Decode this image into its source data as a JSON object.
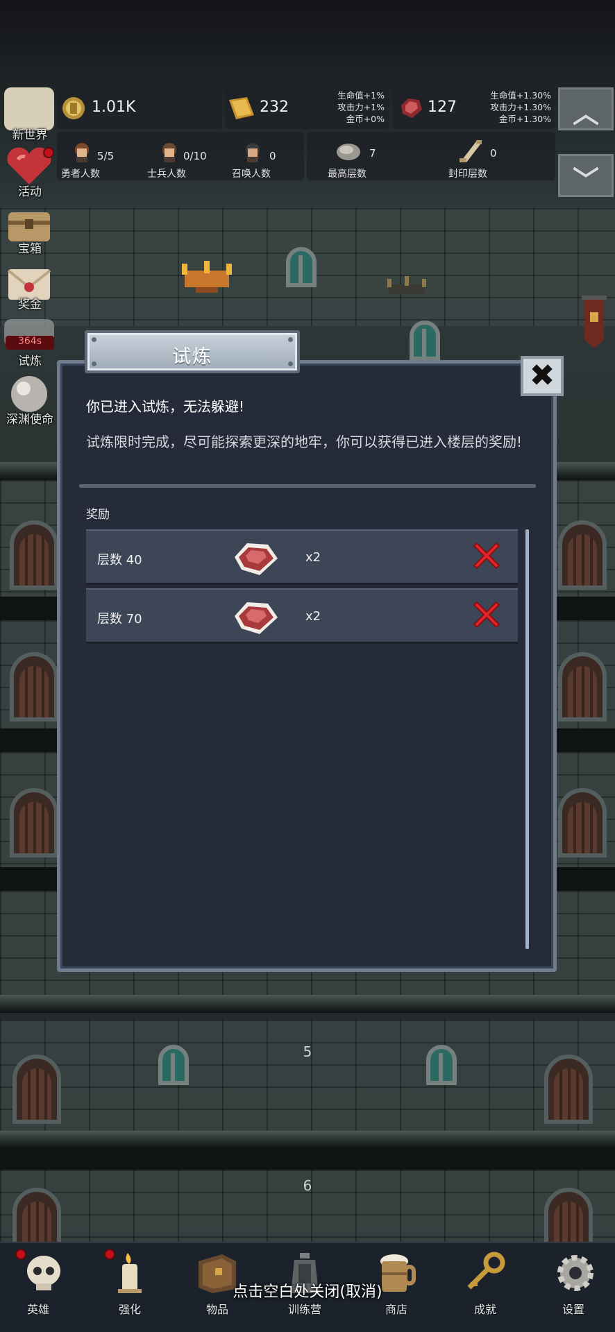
{
  "resources": {
    "gold": "1.01K",
    "bread": "232",
    "bread_bonus": [
      "生命值+1%",
      "攻击力+1%",
      "金币+0%"
    ],
    "gem": "127",
    "gem_bonus": [
      "生命值+1.30%",
      "攻击力+1.30%",
      "金币+1.30%"
    ]
  },
  "counts": [
    {
      "value": "5/5",
      "label": "勇者人数"
    },
    {
      "value": "0/10",
      "label": "士兵人数"
    },
    {
      "value": "0",
      "label": "召唤人数"
    },
    {
      "value": "7",
      "label": "最高层数"
    },
    {
      "value": "0",
      "label": "封印层数"
    }
  ],
  "left_menu": [
    {
      "label": "新世界"
    },
    {
      "label": "活动"
    },
    {
      "label": "宝箱"
    },
    {
      "label": "奖金"
    },
    {
      "label": "试炼",
      "badge": "364s"
    },
    {
      "label": "深渊使命"
    }
  ],
  "floors": [
    "5",
    "6"
  ],
  "modal": {
    "title": "试炼",
    "message_1": "你已进入试炼，无法躲避!",
    "message_2": "试炼限时完成，尽可能探索更深的地牢，你可以获得已进入楼层的奖励!",
    "rewards_heading": "奖励",
    "rows": [
      {
        "label": "层数 40",
        "qty": "x2"
      },
      {
        "label": "层数 70",
        "qty": "x2"
      }
    ]
  },
  "bottom_nav": [
    {
      "label": "英雄"
    },
    {
      "label": "强化"
    },
    {
      "label": "物品"
    },
    {
      "label": "训练营"
    },
    {
      "label": "商店"
    },
    {
      "label": "成就"
    },
    {
      "label": "设置"
    }
  ],
  "tap_to_close": "点击空白处关闭(取消)",
  "colors": {
    "modal_bg": "#252b39",
    "row_bg": "#3d4656",
    "badge_red": "#c0131b",
    "accent_scroll": "#9fb2c9"
  }
}
